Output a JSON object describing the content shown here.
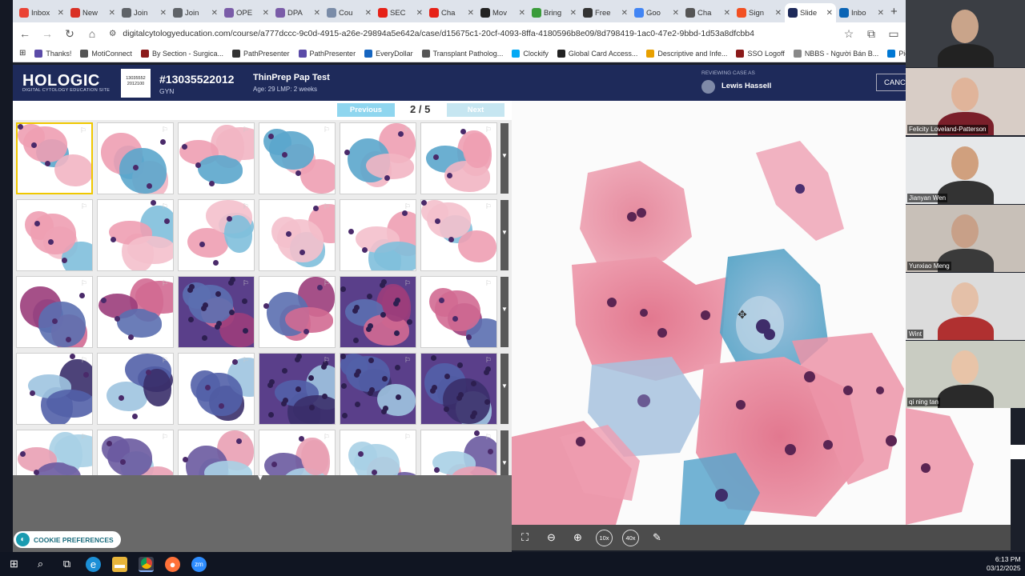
{
  "browser": {
    "tabs": [
      {
        "label": "Inbox",
        "color": "#ea4335"
      },
      {
        "label": "New",
        "color": "#d93025"
      },
      {
        "label": "Join",
        "color": "#5f6368"
      },
      {
        "label": "Join",
        "color": "#5f6368"
      },
      {
        "label": "OPE",
        "color": "#7a5ca8"
      },
      {
        "label": "DPA",
        "color": "#7a5ca8"
      },
      {
        "label": "Cou",
        "color": "#7a8ca8"
      },
      {
        "label": "SEC",
        "color": "#e62117"
      },
      {
        "label": "Cha",
        "color": "#e62117"
      },
      {
        "label": "Mov",
        "color": "#222222"
      },
      {
        "label": "Bring",
        "color": "#3a9c3a"
      },
      {
        "label": "Free",
        "color": "#333333"
      },
      {
        "label": "Goo",
        "color": "#4285f4"
      },
      {
        "label": "Cha",
        "color": "#555555"
      },
      {
        "label": "Sign",
        "color": "#f25022"
      },
      {
        "label": "Slide",
        "color": "#1e2a5a"
      },
      {
        "label": "Inbo",
        "color": "#0a64b5"
      }
    ],
    "url": "digitalcytologyeducation.com/course/a777dccc-9c0d-4915-a26e-29894a5e642a/case/d15675c1-20cf-4093-8ffa-4180596b8e09/8d798419-1ac0-47e2-9bbd-1d53a8dfcbb4",
    "bookmarks": [
      {
        "label": "Thanks!",
        "color": "#5b4ba8"
      },
      {
        "label": "MotiConnect",
        "color": "#555"
      },
      {
        "label": "By Section - Surgica...",
        "color": "#8b1a1a"
      },
      {
        "label": "PathPresenter",
        "color": "#333"
      },
      {
        "label": "PathPresenter",
        "color": "#5b4ba8"
      },
      {
        "label": "EveryDollar",
        "color": "#1565c0"
      },
      {
        "label": "Transplant Patholog...",
        "color": "#555"
      },
      {
        "label": "Clockify",
        "color": "#03a9f4"
      },
      {
        "label": "Global Card Access...",
        "color": "#222"
      },
      {
        "label": "Descriptive and Infe...",
        "color": "#e8a000"
      },
      {
        "label": "SSO Logoff",
        "color": "#8b1a1a"
      },
      {
        "label": "NBBS - Người Bán B...",
        "color": "#888"
      },
      {
        "label": "Picture library - One...",
        "color": "#0078d4"
      }
    ]
  },
  "header": {
    "logo": "HOLOGIC",
    "logo_sub": "DIGITAL CYTOLOGY EDUCATION SITE",
    "barcode_text": "13035552\n2012100",
    "case_id": "#13035522012",
    "case_type": "GYN",
    "test_name": "ThinPrep Pap Test",
    "test_meta": "Age: 29   LMP: 2 weeks",
    "reviewing_label": "REVIEWING CASE AS",
    "reviewer": "Lewis Hassell",
    "cancel_label": "CANCEL"
  },
  "pager": {
    "prev_label": "Previous",
    "page": "2 / 5",
    "next_label": "Next"
  },
  "thumbnails": {
    "rows": 5,
    "cols": 6,
    "selected_index": 0
  },
  "toolbar": {
    "tools": [
      {
        "name": "fullscreen-icon",
        "glyph": "⛶"
      },
      {
        "name": "zoom-out-icon",
        "glyph": "⊖"
      },
      {
        "name": "zoom-in-icon",
        "glyph": "⊕"
      },
      {
        "name": "zoom-10x-button",
        "glyph": "10x"
      },
      {
        "name": "zoom-40x-button",
        "glyph": "40x"
      },
      {
        "name": "pen-icon",
        "glyph": "✎"
      }
    ]
  },
  "cookie": {
    "label": "COOKIE PREFERENCES"
  },
  "participants": [
    {
      "name": ""
    },
    {
      "name": "Felicity Loveland-Patterson"
    },
    {
      "name": "Jianyan Wen"
    },
    {
      "name": "Yunxiao Meng"
    },
    {
      "name": "Wint"
    },
    {
      "name": "qi ning tan"
    }
  ],
  "clock": {
    "time": "6:13 PM",
    "date": "03/12/2025"
  }
}
